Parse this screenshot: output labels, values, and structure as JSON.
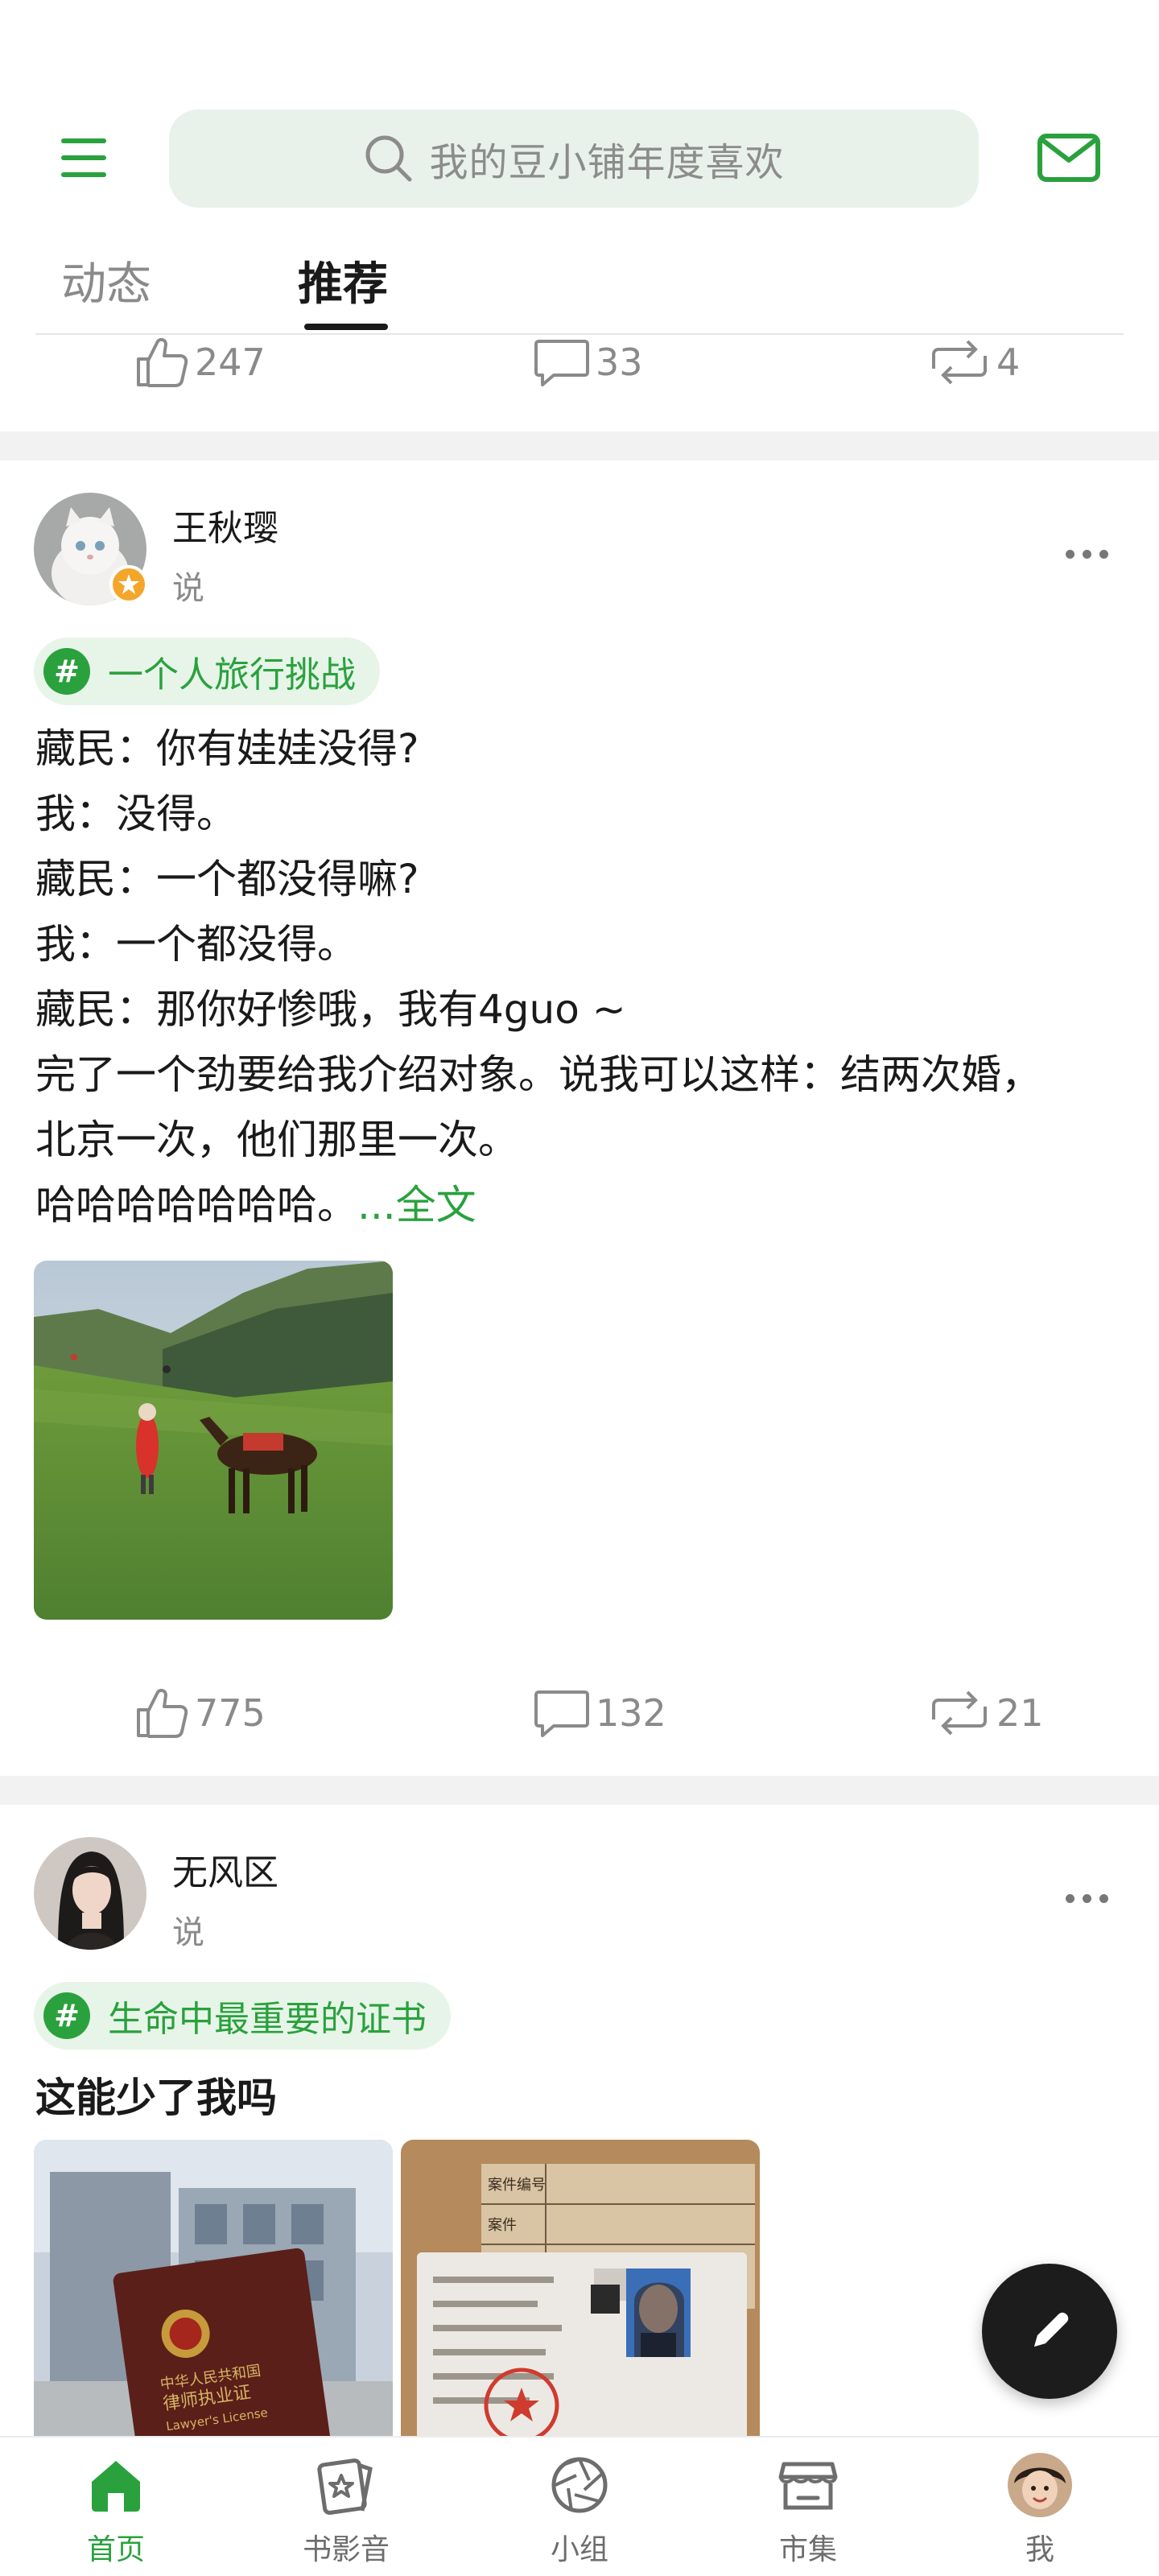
{
  "header": {
    "search_placeholder": "我的豆小铺年度喜欢",
    "tabs": [
      "动态",
      "推荐"
    ],
    "active_tab": "推荐"
  },
  "previous_post_actions": {
    "likes": "247",
    "comments": "33",
    "reposts": "4"
  },
  "posts": [
    {
      "user_name": "王秋璎",
      "action": "说",
      "topic": "一个人旅行挑战",
      "lines": [
        "藏民：你有娃娃没得?",
        "我：没得。",
        "藏民：一个都没得嘛?",
        "我：一个都没得。",
        "藏民：那你好惨哦，我有4guo ~",
        "完了一个劲要给我介绍对象。说我可以这样：结两次婚，",
        "北京一次，他们那里一次。",
        "哈哈哈哈哈哈哈。"
      ],
      "full_text_link": "...全文",
      "likes": "775",
      "comments": "132",
      "reposts": "21"
    },
    {
      "user_name": "无风区",
      "action": "说",
      "topic": "生命中最重要的证书",
      "text": "这能少了我吗",
      "image_texts": {
        "cert_line1": "中华人民共和国",
        "cert_line2": "律师执业证",
        "cert_line3": "Lawyer's License",
        "case_number": "案件编号",
        "case": "案件"
      }
    }
  ],
  "bottom_nav": [
    "首页",
    "书影音",
    "小组",
    "市集",
    "我"
  ],
  "active_nav": "首页",
  "colors": {
    "accent": "#2aa13d",
    "search_bg": "#e8f2ea",
    "topic_bg": "#e7f5e9",
    "fab": "#1c1c1c"
  }
}
